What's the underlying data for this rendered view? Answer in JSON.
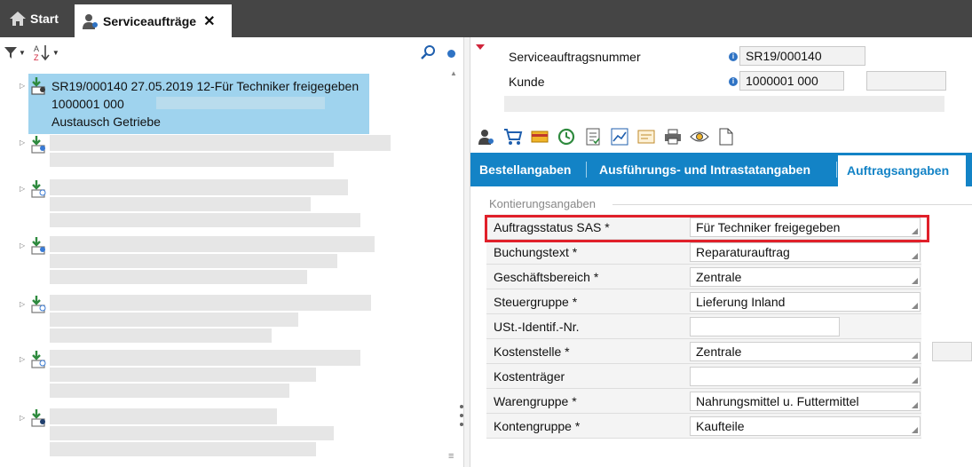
{
  "tabs": {
    "start_label": "Start",
    "active_label": "Serviceaufträge",
    "close_glyph": "✕"
  },
  "left": {
    "toolbar": {
      "filter_icon": "filter-icon",
      "sort_icon": "sort-az-icon",
      "sort_label": "A Z"
    },
    "selected": {
      "line1": "SR19/000140 27.05.2019 12-Für Techniker freigegeben",
      "line2": "1000001 000",
      "line3": "Austausch Getriebe"
    }
  },
  "header": {
    "order_number_label": "Serviceauftragsnummer",
    "order_number_value": "SR19/000140",
    "customer_label": "Kunde",
    "customer_value": "1000001 000"
  },
  "detail_tabs": [
    {
      "label": "Bestellangaben"
    },
    {
      "label": "Ausführungs- und Intrastatangaben"
    },
    {
      "label": "Auftragsangaben"
    }
  ],
  "section": {
    "title": "Kontierungsangaben"
  },
  "form": {
    "rows": [
      {
        "label": "Auftragsstatus SAS *",
        "value": "Für Techniker freigegeben"
      },
      {
        "label": "Buchungstext *",
        "value": "Reparaturauftrag"
      },
      {
        "label": "Geschäftsbereich *",
        "value": "Zentrale"
      },
      {
        "label": "Steuergruppe *",
        "value": "Lieferung Inland"
      },
      {
        "label": "USt.-Identif.-Nr.",
        "value": ""
      },
      {
        "label": "Kostenstelle *",
        "value": "Zentrale"
      },
      {
        "label": "Kostenträger",
        "value": ""
      },
      {
        "label": "Warengruppe *",
        "value": "Nahrungsmittel u. Futtermittel"
      },
      {
        "label": "Kontengruppe *",
        "value": "Kaufteile"
      }
    ]
  },
  "colors": {
    "accent": "#1383c6",
    "selection": "#9fd3ee",
    "highlight": "#e0202a",
    "titlebar": "#454545"
  }
}
